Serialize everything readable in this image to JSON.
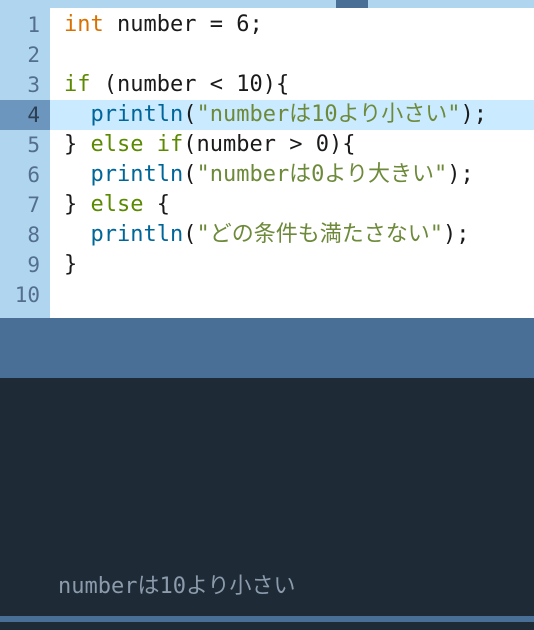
{
  "editor": {
    "highlighted_line": 4,
    "tokens": [
      [
        {
          "t": "int",
          "c": "kw-type"
        },
        {
          "t": " ",
          "c": ""
        },
        {
          "t": "number",
          "c": "ident"
        },
        {
          "t": " = ",
          "c": "punct"
        },
        {
          "t": "6",
          "c": "ident"
        },
        {
          "t": ";",
          "c": "punct"
        }
      ],
      [],
      [
        {
          "t": "if",
          "c": "kw-ctrl"
        },
        {
          "t": " (",
          "c": "punct"
        },
        {
          "t": "number",
          "c": "ident"
        },
        {
          "t": " < ",
          "c": "punct"
        },
        {
          "t": "10",
          "c": "ident"
        },
        {
          "t": "){",
          "c": "punct"
        }
      ],
      [
        {
          "t": "  ",
          "c": ""
        },
        {
          "t": "println",
          "c": "fn"
        },
        {
          "t": "(",
          "c": "punct"
        },
        {
          "t": "\"numberは10より小さい\"",
          "c": "str"
        },
        {
          "t": ");",
          "c": "punct"
        }
      ],
      [
        {
          "t": "} ",
          "c": "punct"
        },
        {
          "t": "else if",
          "c": "kw-ctrl"
        },
        {
          "t": "(",
          "c": "punct"
        },
        {
          "t": "number",
          "c": "ident"
        },
        {
          "t": " > ",
          "c": "punct"
        },
        {
          "t": "0",
          "c": "ident"
        },
        {
          "t": "){",
          "c": "punct"
        }
      ],
      [
        {
          "t": "  ",
          "c": ""
        },
        {
          "t": "println",
          "c": "fn"
        },
        {
          "t": "(",
          "c": "punct"
        },
        {
          "t": "\"numberは0より大きい\"",
          "c": "str"
        },
        {
          "t": ");",
          "c": "punct"
        }
      ],
      [
        {
          "t": "} ",
          "c": "punct"
        },
        {
          "t": "else",
          "c": "kw-ctrl"
        },
        {
          "t": " {",
          "c": "punct"
        }
      ],
      [
        {
          "t": "  ",
          "c": ""
        },
        {
          "t": "println",
          "c": "fn"
        },
        {
          "t": "(",
          "c": "punct"
        },
        {
          "t": "\"どの条件も満たさない\"",
          "c": "str"
        },
        {
          "t": ");",
          "c": "punct"
        }
      ],
      [
        {
          "t": "}",
          "c": "punct"
        }
      ],
      []
    ],
    "line_numbers": [
      "1",
      "2",
      "3",
      "4",
      "5",
      "6",
      "7",
      "8",
      "9",
      "10"
    ]
  },
  "console": {
    "output": "numberは10より小さい"
  }
}
